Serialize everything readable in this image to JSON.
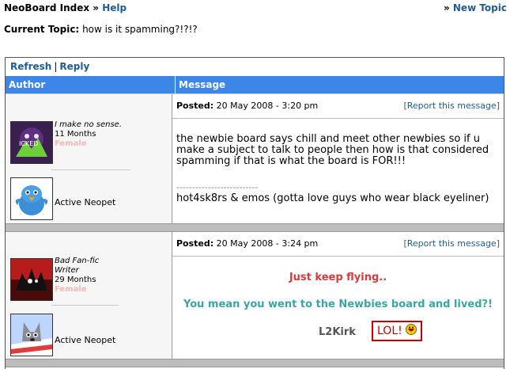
{
  "nav": {
    "index_label": "NeoBoard Index",
    "arrow": "»",
    "help_label": "Help",
    "new_topic_label": "New Topic"
  },
  "current_topic": {
    "label": "Current Topic:",
    "value": "how is it spamming?!?!?"
  },
  "actions": {
    "refresh_label": "Refresh",
    "separator": "|",
    "reply_label": "Reply"
  },
  "table": {
    "author_header": "Author",
    "message_header": "Message"
  },
  "posts": [
    {
      "author_title": "I make no sense.",
      "author_months": "11 Months",
      "author_gender": "Female",
      "pet_label": "Active Neopet",
      "posted_label": "Posted:",
      "posted_date": "20 May 2008 - 3:20 pm",
      "report_label": "Report this message",
      "body": "the newbie board says chill and meet other newbies so if u make a subject to talk to people then how is that considered spamming if that is what the board is FOR!!!",
      "sig_divider": "--------------------------",
      "signature": "hot4sk8rs & emos (gotta love guys who wear black eyeliner)"
    },
    {
      "author_title": "Bad Fan-fic Writer",
      "author_months": "29 Months",
      "author_gender": "Female",
      "pet_label": "Active Neopet",
      "posted_label": "Posted:",
      "posted_date": "20 May 2008 - 3:24 pm",
      "report_label": "Report this message",
      "line1": "Just keep flying..",
      "line2": "You mean you went to the Newbies board and lived?!",
      "sig_name": "L2Kirk",
      "lol": "LOL!"
    }
  ],
  "colors": {
    "link": "#1F5E93",
    "header_bg": "#3B86E6",
    "red_text": "#D93A3A",
    "teal_text": "#3AA6A0"
  }
}
